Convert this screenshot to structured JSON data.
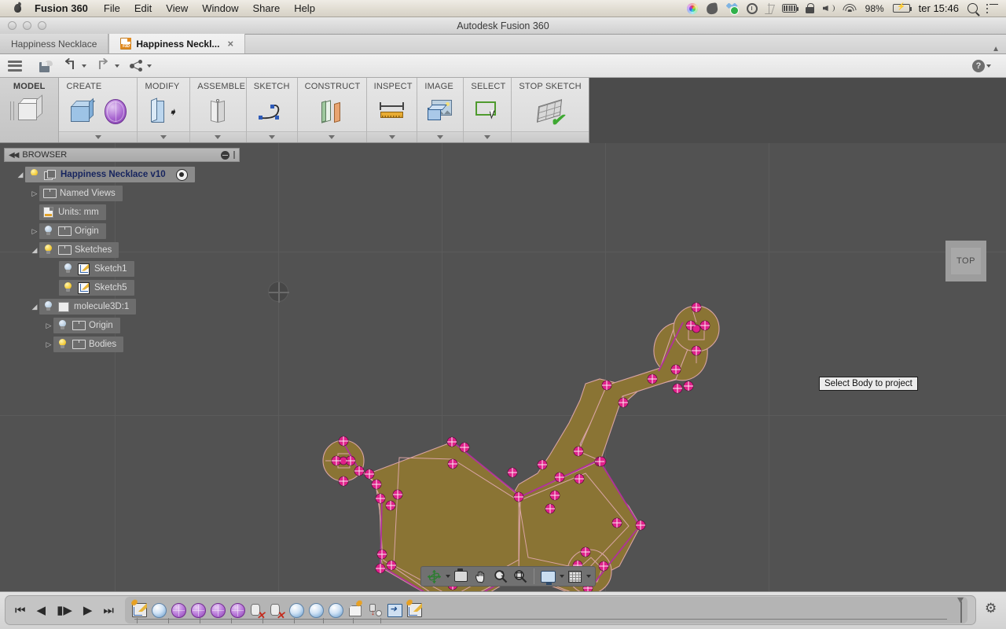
{
  "macbar": {
    "app_name": "Fusion 360",
    "menus": [
      "File",
      "Edit",
      "View",
      "Window",
      "Share",
      "Help"
    ],
    "status_icons": [
      "color-wheel-icon",
      "evernote-icon",
      "dropbox-icon",
      "timemachine-icon",
      "bluetooth-icon",
      "battery-meter-icon",
      "lock-icon",
      "volume-icon",
      "wifi-icon"
    ],
    "battery_percent": "98%",
    "clock": "ter 15:46",
    "spotlight_icon": "search-icon",
    "notification_icon": "list-icon"
  },
  "window": {
    "title": "Autodesk Fusion 360"
  },
  "tabs": [
    {
      "label": "Happiness Necklace",
      "active": false,
      "closable": false
    },
    {
      "label": "Happiness Neckl...",
      "active": true,
      "closable": true,
      "icon": "f3d-file-icon",
      "close_glyph": "×"
    }
  ],
  "quick_access": {
    "menu_icon": "hamburger-menu-icon",
    "save_icon": "save-cloud-icon",
    "undo_icon": "undo-arrow-icon",
    "redo_icon": "redo-arrow-icon",
    "share_icon": "share-icon",
    "help_label": "?",
    "help_icon": "help-icon"
  },
  "ribbon": {
    "workspace": {
      "label": "MODEL",
      "icon": "model-cube-icon"
    },
    "groups": [
      {
        "label": "CREATE",
        "has_dropdown": true,
        "tools": [
          "box-icon",
          "sphere-icon"
        ]
      },
      {
        "label": "MODIFY",
        "has_dropdown": true,
        "tools": [
          "press-pull-icon"
        ]
      },
      {
        "label": "ASSEMBLE",
        "has_dropdown": true,
        "tools": [
          "joint-icon"
        ]
      },
      {
        "label": "SKETCH",
        "has_dropdown": true,
        "tools": [
          "spline-icon"
        ]
      },
      {
        "label": "CONSTRUCT",
        "has_dropdown": true,
        "tools": [
          "construction-plane-icon"
        ]
      },
      {
        "label": "INSPECT",
        "has_dropdown": true,
        "tools": [
          "measure-icon"
        ]
      },
      {
        "label": "IMAGE",
        "has_dropdown": true,
        "tools": [
          "canvas-image-icon"
        ]
      },
      {
        "label": "SELECT",
        "has_dropdown": true,
        "tools": [
          "select-window-icon"
        ]
      },
      {
        "label": "STOP SKETCH",
        "has_dropdown": false,
        "tools": [
          "stop-sketch-icon"
        ]
      }
    ]
  },
  "browser": {
    "header": "BROWSER",
    "collapse_glyph": "◀◀",
    "minimize_icon": "minimize-icon",
    "tree": [
      {
        "label": "Happiness Necklace v10",
        "indent": 0,
        "expander": "expanded",
        "bulb": "on",
        "icon": "component-icon",
        "root": true,
        "trailing_icon": "activate-target-icon"
      },
      {
        "label": "Named Views",
        "indent": 1,
        "expander": "collapsed",
        "bulb": "none",
        "icon": "folder-icon"
      },
      {
        "label": "Units: mm",
        "indent": 1,
        "expander": "none",
        "bulb": "none",
        "icon": "units-doc-icon"
      },
      {
        "label": "Origin",
        "indent": 1,
        "expander": "collapsed",
        "bulb": "off",
        "icon": "folder-icon"
      },
      {
        "label": "Sketches",
        "indent": 1,
        "expander": "expanded",
        "bulb": "on",
        "icon": "folder-icon"
      },
      {
        "label": "Sketch1",
        "indent": 2,
        "expander": "none",
        "bulb": "off",
        "icon": "sketch-icon"
      },
      {
        "label": "Sketch5",
        "indent": 2,
        "expander": "none",
        "bulb": "on",
        "icon": "sketch-icon"
      },
      {
        "label": "molecule3D:1",
        "indent": 1,
        "expander": "expanded",
        "bulb": "off",
        "icon": "body-icon"
      },
      {
        "label": "Origin",
        "indent": 2,
        "expander": "collapsed",
        "bulb": "off",
        "icon": "folder-icon"
      },
      {
        "label": "Bodies",
        "indent": 2,
        "expander": "collapsed",
        "bulb": "on",
        "icon": "folder-icon"
      }
    ]
  },
  "canvas": {
    "tooltip": "Select Body to project",
    "viewcube_label": "TOP",
    "background_color": "#525252",
    "sketch_fill_color": "#8a7434",
    "sketch_curve_color": "#d9a4a4",
    "sketch_profile_color": "#b0309b",
    "sketch_point_color": "#e0218a",
    "origin_marker_icon": "origin-marker-icon"
  },
  "view_toolbar": {
    "buttons": [
      "orbit-icon",
      "look-at-icon",
      "pan-icon",
      "zoom-icon",
      "zoom-window-icon",
      "display-settings-icon",
      "grid-snap-icon"
    ],
    "dropdowns": [
      "orbit-dropdown",
      "display-dropdown",
      "grid-dropdown"
    ]
  },
  "timeline": {
    "nav_buttons": [
      "go-to-start-icon",
      "step-back-icon",
      "step-forward-icon",
      "play-icon",
      "go-to-end-icon"
    ],
    "features": [
      "sketch-icon",
      "extrude-icon",
      "revolve-icon",
      "revolve-icon",
      "revolve-icon",
      "revolve-icon",
      "delete-face-icon",
      "delete-face-icon",
      "extrude-icon",
      "extrude-icon",
      "extrude-icon",
      "combine-icon",
      "thread-icon",
      "move-icon",
      "sketch-icon"
    ],
    "marker_icon": "timeline-marker-icon",
    "settings_icon": "gear-icon"
  }
}
